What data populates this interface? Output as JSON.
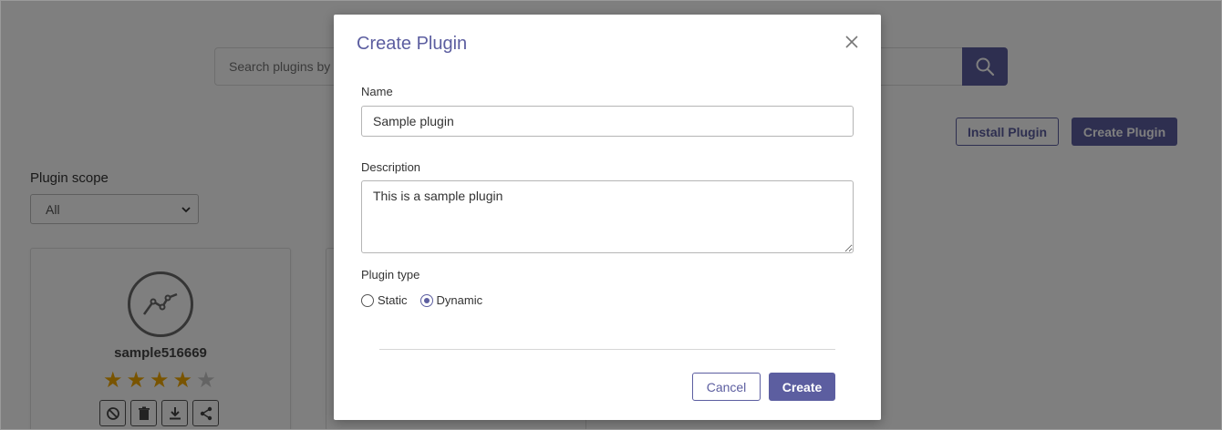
{
  "background": {
    "search": {
      "placeholder": "Search plugins by name"
    },
    "install_label": "Install Plugin",
    "create_label": "Create Plugin",
    "scope": {
      "label": "Plugin scope",
      "selected": "All"
    },
    "cards": [
      {
        "name": "sample516669",
        "rating": 4,
        "rating_max": 5
      }
    ]
  },
  "modal": {
    "title": "Create Plugin",
    "name_label": "Name",
    "name_value": "Sample plugin",
    "description_label": "Description",
    "description_value": "This is a sample plugin",
    "type_label": "Plugin type",
    "type_options": [
      "Static",
      "Dynamic"
    ],
    "type_selected": "Dynamic",
    "cancel_label": "Cancel",
    "create_label": "Create"
  },
  "colors": {
    "accent": "#5c5ea0",
    "overlay": "rgba(0,0,0,0.5)",
    "star_on": "#f2a900",
    "star_off": "#c9c9c9"
  }
}
